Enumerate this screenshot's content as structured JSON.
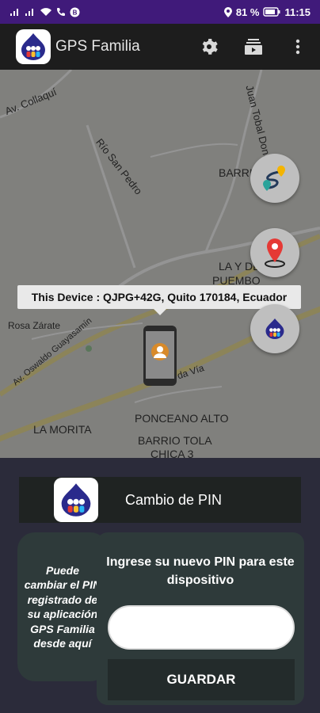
{
  "status_bar": {
    "battery": "81 %",
    "time": "11:15",
    "icons_left": [
      "signal-icon",
      "signal-icon",
      "wifi-call-icon",
      "phone-icon",
      "app-notification-icon"
    ],
    "icons_right": [
      "location-icon",
      "battery-icon"
    ],
    "bg_color": "#401a7a"
  },
  "app_bar": {
    "title": "GPS Familia",
    "actions": [
      "settings-icon",
      "subscriptions-icon",
      "more-vert-icon"
    ]
  },
  "map": {
    "labels": {
      "av_collaqui": "Av. Collaquí",
      "juan_tobal": "Juan Tobal Dona...",
      "barrio": "BARRIO",
      "san_pedro": "Río San Pedro",
      "la_y": "LA Y DE",
      "puembo": "PUEMBO",
      "rosa_zarate": "Rosa Zárate",
      "oswaldo": "Av. Oswaldo Guayasamín",
      "via": "da Vía",
      "ponceano": "PONCEANO ALTO",
      "la_morita": "LA MORITA",
      "barrio_tola": "BARRIO TOLA",
      "chica3": "CHICA 3"
    },
    "device_tooltip": "This Device : QJPG+42G, Quito 170184, Ecuador",
    "fabs": [
      "route-icon",
      "map-pin-icon",
      "app-logo-icon"
    ]
  },
  "pin_panel": {
    "title": "Cambio de PIN",
    "info_text": "Puede cambiar el PIN registrado de su aplicación GPS Familia desde aquí",
    "prompt": "Ingrese su nuevo PIN para este dispositivo",
    "input_value": "",
    "input_placeholder": "",
    "save_label": "GUARDAR"
  }
}
